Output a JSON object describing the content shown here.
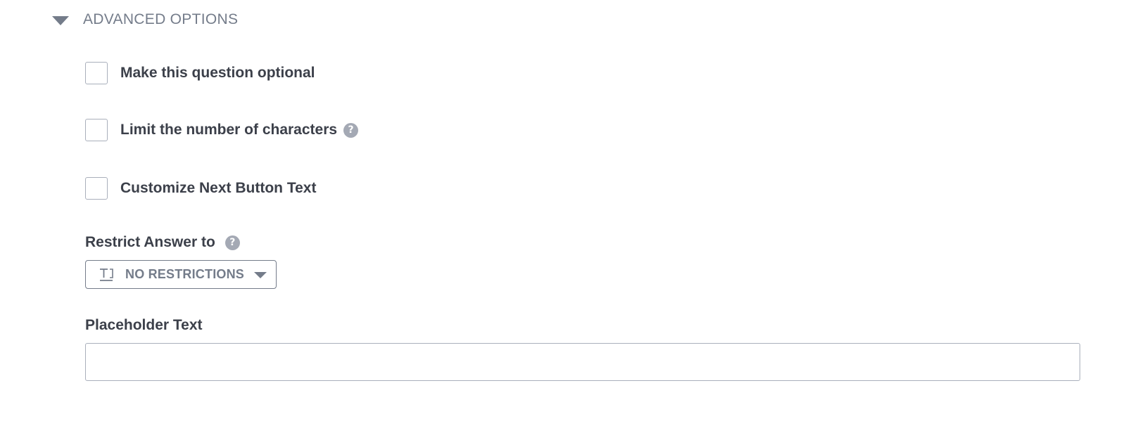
{
  "advanced_options": {
    "title": "ADVANCED OPTIONS",
    "expanded": true
  },
  "options": [
    {
      "label": "Make this question optional",
      "checked": false,
      "has_help": false
    },
    {
      "label": "Limit the number of characters",
      "checked": false,
      "has_help": true
    },
    {
      "label": "Customize Next Button Text",
      "checked": false,
      "has_help": false
    }
  ],
  "restrict_answer": {
    "label": "Restrict Answer to",
    "selected": "NO RESTRICTIONS",
    "icon": "text-type-icon"
  },
  "placeholder_text": {
    "label": "Placeholder Text",
    "value": ""
  },
  "colors": {
    "text_primary": "#3c404a",
    "text_muted": "#747c8a",
    "border": "#a9afbb",
    "help_icon": "#a4a9b4"
  }
}
